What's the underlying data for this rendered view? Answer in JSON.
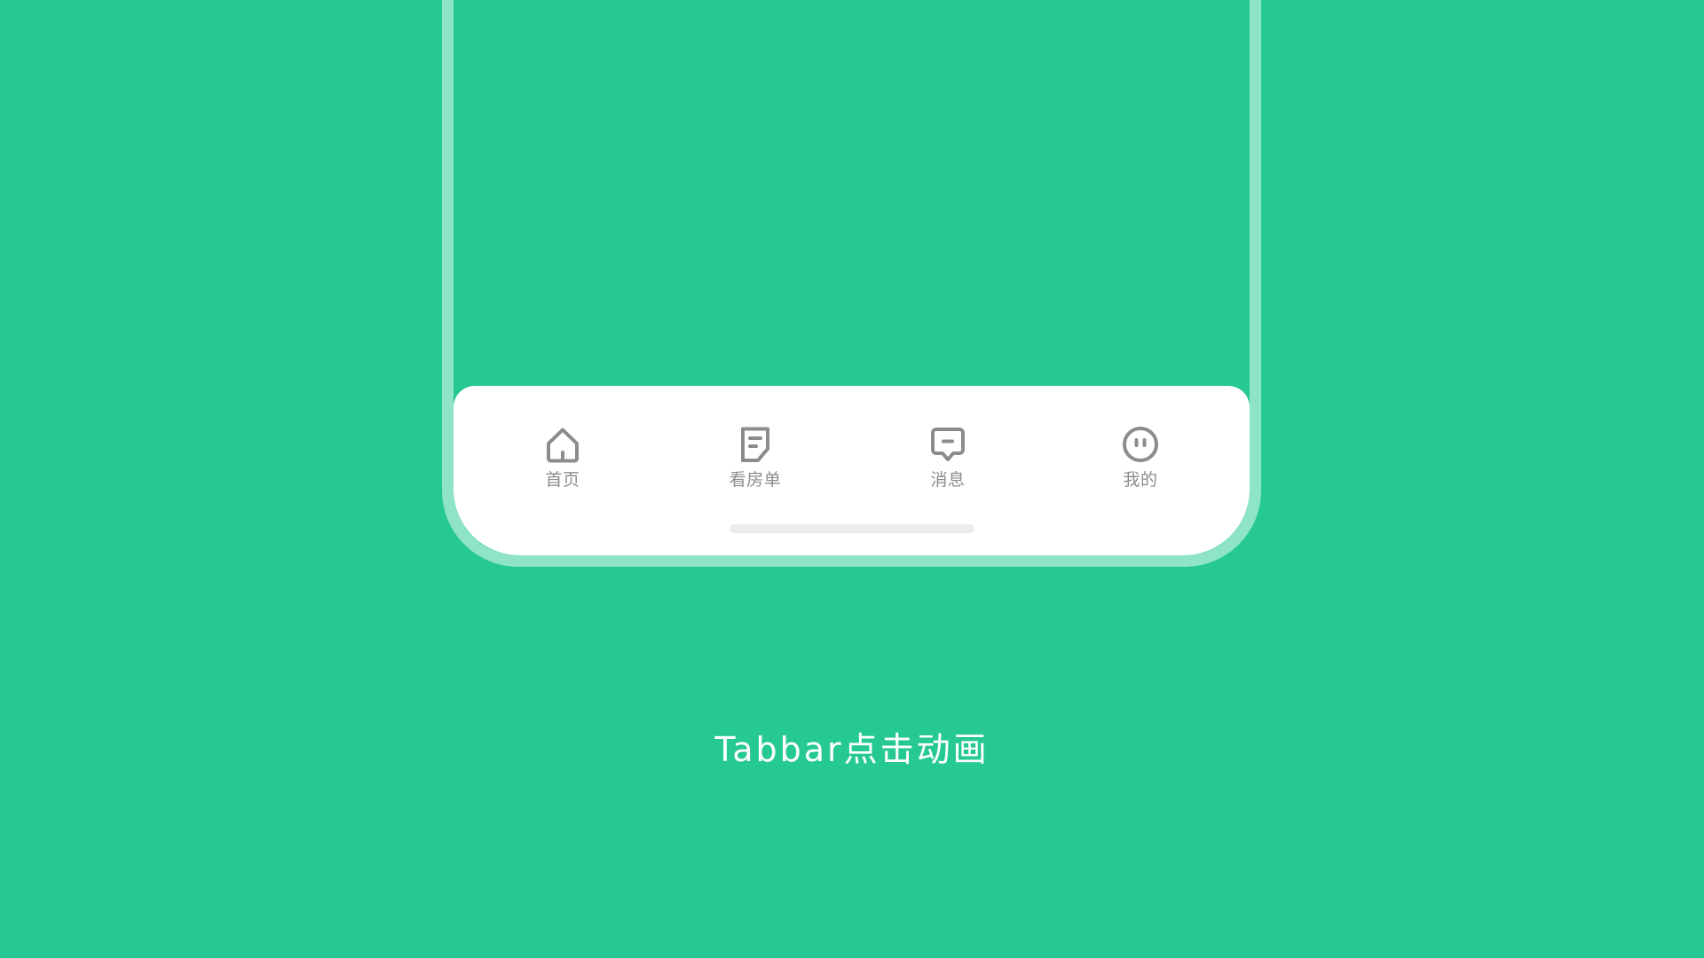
{
  "colors": {
    "background": "#26c993",
    "frame": "#8fe4c7",
    "tabbar": "#ffffff",
    "icon": "#8c8c8c",
    "indicator": "#ececec",
    "caption": "#ffffff"
  },
  "tabbar": {
    "items": [
      {
        "label": "首页",
        "icon": "home-icon"
      },
      {
        "label": "看房单",
        "icon": "document-icon"
      },
      {
        "label": "消息",
        "icon": "message-icon"
      },
      {
        "label": "我的",
        "icon": "profile-face-icon"
      }
    ]
  },
  "caption": "Tabbar点击动画"
}
